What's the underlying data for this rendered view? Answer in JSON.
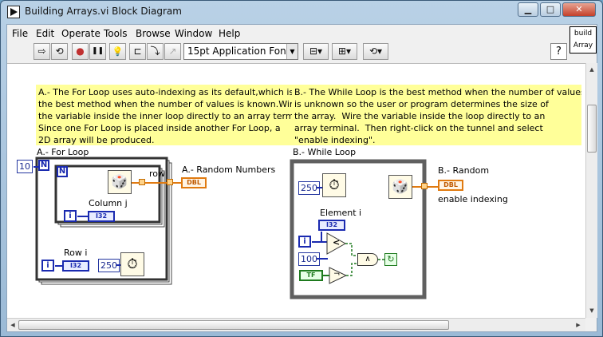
{
  "window": {
    "title": "Building Arrays.vi Block Diagram"
  },
  "title_buttons": {
    "minimize": "▁",
    "maximize": "□",
    "close": "✕"
  },
  "menu": [
    "File",
    "Edit",
    "Operate",
    "Tools",
    "Browse",
    "Window",
    "Help"
  ],
  "toolbar": {
    "run": "⇨",
    "run_continuous": "⟲",
    "abort": "●",
    "pause": "❚❚",
    "highlight": "💡",
    "font": "15pt Application Font",
    "font_arrow": "▼",
    "align": "⊟▾",
    "distribute": "⊞▾",
    "reorder": "⟲▾",
    "help": "?"
  },
  "vi_icon": {
    "line1": "build",
    "line2": "Array"
  },
  "notes": {
    "for_loop_note": "A.- The For Loop uses auto-indexing as its default,which is\nthe best method when the number of values is known.Wire\nthe variable inside the inner loop directly to an array terminal.\nSince one For Loop is placed inside another For Loop, a\n2D array will be produced.",
    "while_loop_note": "B.- The While Loop is the best method when the number of values\nis unknown so the user or program determines the size of\nthe array.  Wire the variable inside the loop directly to an\narray terminal.  Then right-click on the tunnel and select\n\"enable indexing\"."
  },
  "for_section": {
    "title": "A.- For Loop",
    "count_const": "10",
    "n_outer": "N",
    "n_inner": "N",
    "column_label": "Column j",
    "column_type": "I32",
    "row_label": "Row i",
    "row_type": "I32",
    "iter_outer": "i",
    "iter_inner": "i",
    "wait_const": "250",
    "tunnel_label": "row",
    "output_label": "A.- Random Numbers",
    "output_type": "DBL"
  },
  "while_section": {
    "title": "B.- While Loop",
    "wait_const": "250",
    "element_label": "Element i",
    "element_type": "I32",
    "iter": "i",
    "limit_const": "100",
    "bool_const": "TF",
    "less_op": "<",
    "not_op": "¬",
    "and_op": "∧",
    "stop_icon": "↻",
    "output_label": "B.- Random",
    "output_label2": "enable indexing",
    "output_type": "DBL"
  },
  "icons": {
    "dice": "🎲",
    "metronome": "⏱"
  }
}
